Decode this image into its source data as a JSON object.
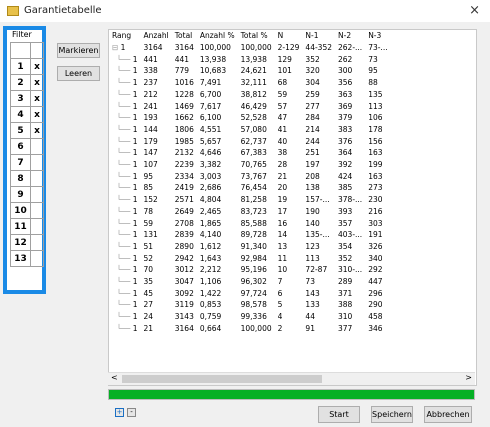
{
  "window": {
    "title": "Garantietabelle",
    "close_glyph": "×"
  },
  "filter": {
    "label": "Filter",
    "rows": [
      {
        "n": "1",
        "x": "x"
      },
      {
        "n": "2",
        "x": "x"
      },
      {
        "n": "3",
        "x": "x"
      },
      {
        "n": "4",
        "x": "x"
      },
      {
        "n": "5",
        "x": "x"
      },
      {
        "n": "6",
        "x": ""
      },
      {
        "n": "7",
        "x": ""
      },
      {
        "n": "8",
        "x": ""
      },
      {
        "n": "9",
        "x": ""
      },
      {
        "n": "10",
        "x": ""
      },
      {
        "n": "11",
        "x": ""
      },
      {
        "n": "12",
        "x": ""
      },
      {
        "n": "13",
        "x": ""
      }
    ]
  },
  "buttons": {
    "mark": "Markieren",
    "clear": "Leeren",
    "start": "Start",
    "save": "Speichern",
    "cancel": "Abbrechen"
  },
  "table": {
    "headers": [
      "Rang",
      "Anzahl",
      "Total",
      "Anzahl %",
      "Total %",
      "N",
      "N-1",
      "N-2",
      "N-3"
    ],
    "root": {
      "rang": "1",
      "cells": [
        "3164",
        "3164",
        "100,000",
        "100,000",
        "2-129",
        "44-352",
        "262-...",
        "73-..."
      ]
    },
    "rows": [
      [
        "1",
        "441",
        "441",
        "13,938",
        "13,938",
        "129",
        "352",
        "262",
        "73"
      ],
      [
        "1",
        "338",
        "779",
        "10,683",
        "24,621",
        "101",
        "320",
        "300",
        "95"
      ],
      [
        "1",
        "237",
        "1016",
        "7,491",
        "32,111",
        "68",
        "304",
        "356",
        "88"
      ],
      [
        "1",
        "212",
        "1228",
        "6,700",
        "38,812",
        "59",
        "259",
        "363",
        "135"
      ],
      [
        "1",
        "241",
        "1469",
        "7,617",
        "46,429",
        "57",
        "277",
        "369",
        "113"
      ],
      [
        "1",
        "193",
        "1662",
        "6,100",
        "52,528",
        "47",
        "284",
        "379",
        "106"
      ],
      [
        "1",
        "144",
        "1806",
        "4,551",
        "57,080",
        "41",
        "214",
        "383",
        "178"
      ],
      [
        "1",
        "179",
        "1985",
        "5,657",
        "62,737",
        "40",
        "244",
        "376",
        "156"
      ],
      [
        "1",
        "147",
        "2132",
        "4,646",
        "67,383",
        "38",
        "251",
        "364",
        "163"
      ],
      [
        "1",
        "107",
        "2239",
        "3,382",
        "70,765",
        "28",
        "197",
        "392",
        "199"
      ],
      [
        "1",
        "95",
        "2334",
        "3,003",
        "73,767",
        "21",
        "208",
        "424",
        "163"
      ],
      [
        "1",
        "85",
        "2419",
        "2,686",
        "76,454",
        "20",
        "138",
        "385",
        "273"
      ],
      [
        "1",
        "152",
        "2571",
        "4,804",
        "81,258",
        "19",
        "157-...",
        "378-...",
        "230"
      ],
      [
        "1",
        "78",
        "2649",
        "2,465",
        "83,723",
        "17",
        "190",
        "393",
        "216"
      ],
      [
        "1",
        "59",
        "2708",
        "1,865",
        "85,588",
        "16",
        "140",
        "357",
        "303"
      ],
      [
        "1",
        "131",
        "2839",
        "4,140",
        "89,728",
        "14",
        "135-...",
        "403-...",
        "191"
      ],
      [
        "1",
        "51",
        "2890",
        "1,612",
        "91,340",
        "13",
        "123",
        "354",
        "326"
      ],
      [
        "1",
        "52",
        "2942",
        "1,643",
        "92,984",
        "11",
        "113",
        "352",
        "340"
      ],
      [
        "1",
        "70",
        "3012",
        "2,212",
        "95,196",
        "10",
        "72-87",
        "310-...",
        "292"
      ],
      [
        "1",
        "35",
        "3047",
        "1,106",
        "96,302",
        "7",
        "73",
        "289",
        "447"
      ],
      [
        "1",
        "45",
        "3092",
        "1,422",
        "97,724",
        "6",
        "143",
        "371",
        "296"
      ],
      [
        "1",
        "27",
        "3119",
        "0,853",
        "98,578",
        "5",
        "133",
        "388",
        "290"
      ],
      [
        "1",
        "24",
        "3143",
        "0,759",
        "99,336",
        "4",
        "44",
        "310",
        "458"
      ],
      [
        "1",
        "21",
        "3164",
        "0,664",
        "100,000",
        "2",
        "91",
        "377",
        "346"
      ]
    ]
  },
  "scroll": {
    "left": "<",
    "right": ">"
  },
  "progress": {
    "percent": 100,
    "color": "#06b025"
  },
  "small_buttons": {
    "plus": "+",
    "minus": "-"
  },
  "colors": {
    "accent": "#1a8ae6"
  }
}
